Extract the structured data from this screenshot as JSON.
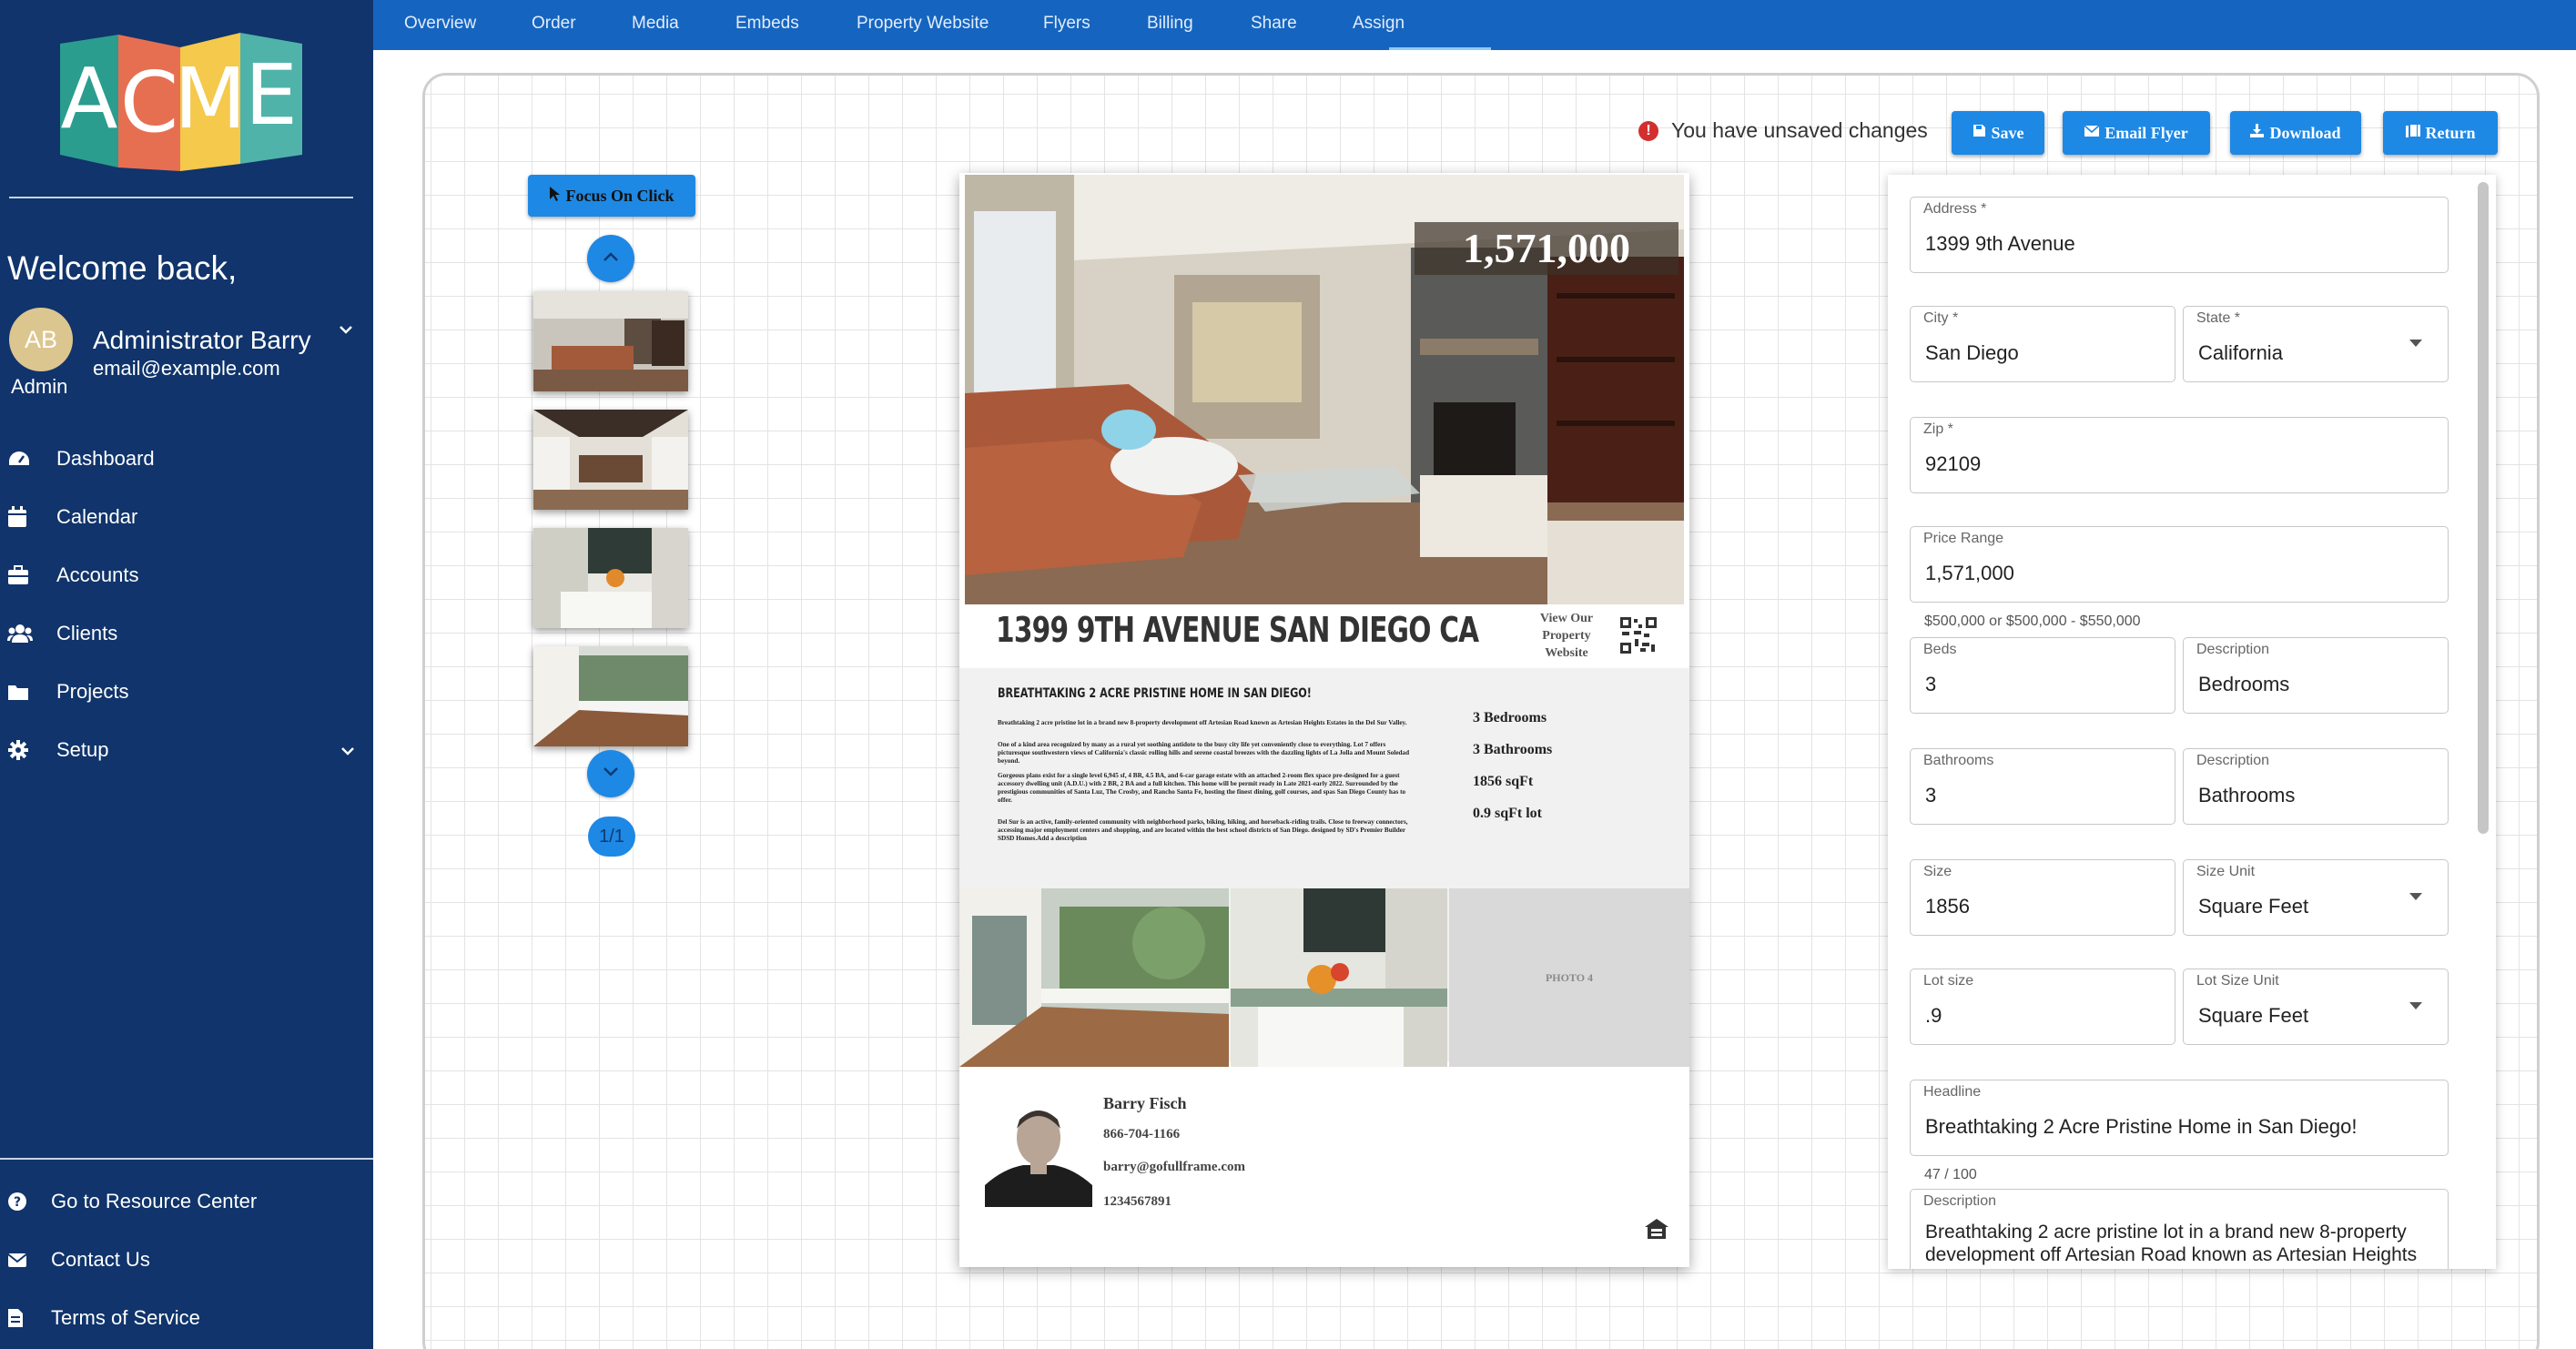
{
  "sidebar": {
    "logo_text": "ACME",
    "welcome": "Welcome back,",
    "user": {
      "initials": "AB",
      "name": "Administrator Barry",
      "email": "email@example.com",
      "role": "Admin"
    },
    "nav": [
      {
        "label": "Dashboard",
        "icon": "dashboard-icon"
      },
      {
        "label": "Calendar",
        "icon": "calendar-icon"
      },
      {
        "label": "Accounts",
        "icon": "briefcase-icon"
      },
      {
        "label": "Clients",
        "icon": "users-icon"
      },
      {
        "label": "Projects",
        "icon": "folder-icon"
      },
      {
        "label": "Setup",
        "icon": "gear-icon"
      }
    ],
    "bottom": [
      {
        "label": "Go to Resource Center",
        "icon": "question-circle-icon"
      },
      {
        "label": "Contact Us",
        "icon": "envelope-icon"
      },
      {
        "label": "Terms of Service",
        "icon": "document-icon"
      }
    ]
  },
  "tabs": [
    "Overview",
    "Order",
    "Media",
    "Embeds",
    "Property Website",
    "Flyers",
    "Billing",
    "Share",
    "Assign"
  ],
  "active_tab": "Flyers",
  "toolbar": {
    "unsaved": "You have unsaved changes",
    "save": "Save",
    "email": "Email Flyer",
    "download": "Download",
    "return": "Return",
    "focus": "Focus On Click",
    "page": "1/1"
  },
  "flyer": {
    "price": "1,571,000",
    "title": "1399 9TH AVENUE SAN DIEGO CA",
    "view_website": "View Our Property Website",
    "headline": "BREATHTAKING 2 ACRE PRISTINE HOME IN SAN DIEGO!",
    "paragraphs": [
      "Breathtaking 2 acre pristine lot in a brand new 8-property development off Artesian Road known as Artesian Heights Estates in the Del Sur Valley.",
      "One of a kind area recognized by many as a rural yet soothing antidote to the busy city life yet conveniently close to everything. Lot 7 offers picturesque southwestern views of California's classic rolling hills and serene coastal breezes with the dazzling lights of La Jolla and Mount Soledad beyond.",
      "Gorgeous plans exist for a single level 6,945 sf, 4 BR, 4.5 BA, and 6-car garage estate with an attached 2-room flex space pre-designed for a guest accessory dwelling unit (A.D.U.) with 2 BR, 2 BA and a full kitchen. This home will be permit ready in Late 2021-early 2022. Surrounded by the prestigious communities of Santa Luz, The Crosby, and Rancho Santa Fe, hosting the finest dining, golf courses, and spas San Diego County has to offer.",
      "Del Sur is an active, family-oriented community with neighborhood parks, biking, hiking, and horseback-riding trails. Close to freeway connectors, accessing major employment centers and shopping, and are located within the best school districts of San Diego. designed by SD's Premier Builder SDSD Homes.Add a description"
    ],
    "features": [
      "3 Bedrooms",
      "3 Bathrooms",
      "1856 sqFt",
      "0.9 sqFt lot"
    ],
    "photo4": "PHOTO 4",
    "agent": {
      "name": "Barry Fisch",
      "phone": "866-704-1166",
      "email": "barry@gofullframe.com",
      "license": "1234567891"
    }
  },
  "form": {
    "address": {
      "label": "Address *",
      "value": "1399 9th Avenue"
    },
    "city": {
      "label": "City *",
      "value": "San Diego"
    },
    "state": {
      "label": "State *",
      "value": "California"
    },
    "zip": {
      "label": "Zip *",
      "value": "92109"
    },
    "price_range": {
      "label": "Price Range",
      "value": "1,571,000",
      "hint": "$500,000 or $500,000 - $550,000"
    },
    "beds": {
      "label": "Beds",
      "value": "3"
    },
    "beds_desc": {
      "label": "Description",
      "value": "Bedrooms"
    },
    "baths": {
      "label": "Bathrooms",
      "value": "3"
    },
    "baths_desc": {
      "label": "Description",
      "value": "Bathrooms"
    },
    "size": {
      "label": "Size",
      "value": "1856"
    },
    "size_unit": {
      "label": "Size Unit",
      "value": "Square Feet"
    },
    "lot_size": {
      "label": "Lot size",
      "value": ".9"
    },
    "lot_unit": {
      "label": "Lot Size Unit",
      "value": "Square Feet"
    },
    "headline": {
      "label": "Headline",
      "value": "Breathtaking 2 Acre Pristine Home in San Diego!",
      "count": "47 / 100"
    },
    "description": {
      "label": "Description",
      "value": "Breathtaking 2 acre pristine lot in a brand new 8-property development off Artesian Road known as Artesian Heights"
    }
  },
  "colors": {
    "sidebar": "#10346b",
    "topbar": "#1565c0",
    "button": "#1e88e5",
    "warning": "#d32f2f"
  }
}
